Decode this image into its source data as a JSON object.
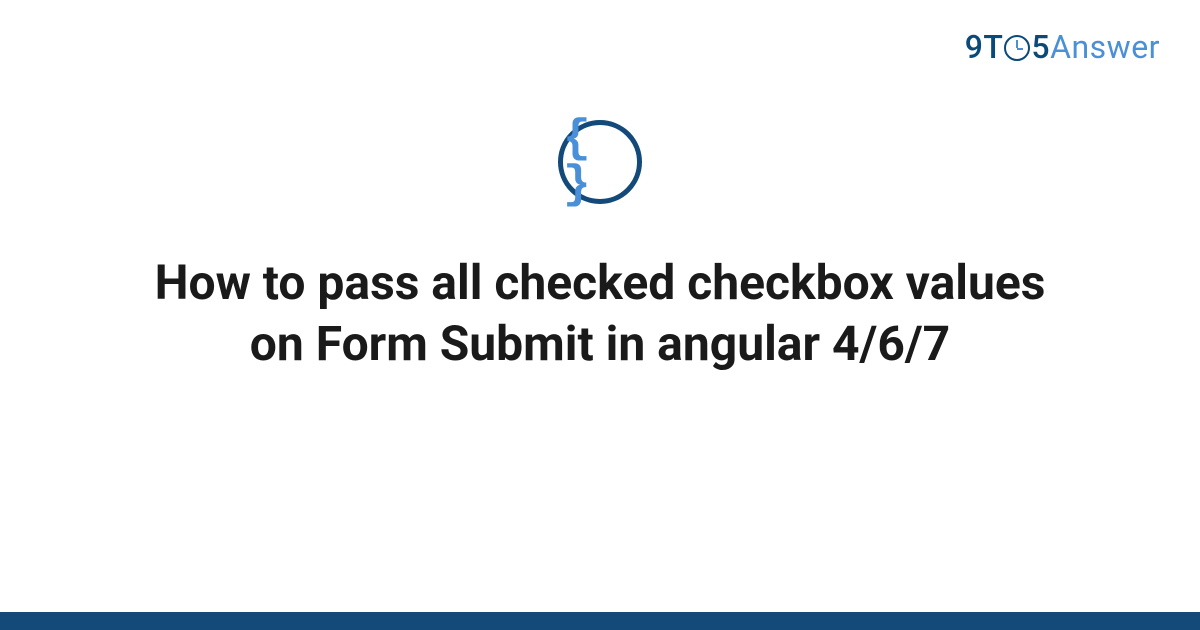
{
  "brand": {
    "nine": "9",
    "t": "T",
    "five": "5",
    "answer": "Answer"
  },
  "icon": {
    "braces": "{ }"
  },
  "title": "How to pass all checked checkbox values on Form Submit in angular 4/6/7",
  "colors": {
    "dark_blue": "#134a7a",
    "light_blue": "#4a90d9",
    "text": "#1a1a1a"
  }
}
